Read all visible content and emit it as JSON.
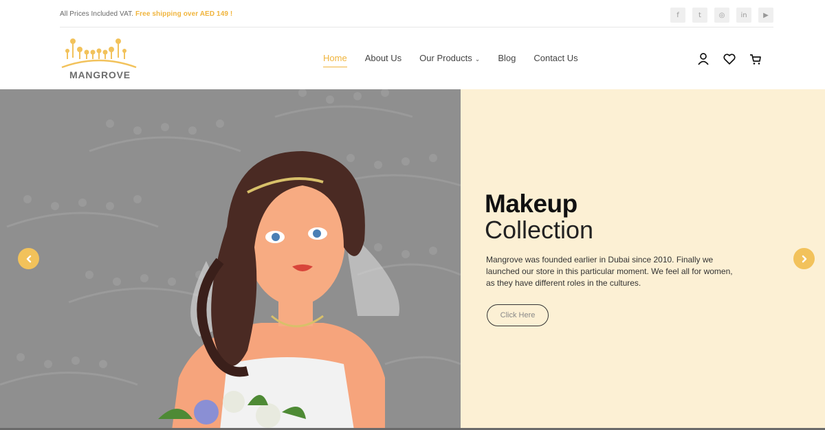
{
  "topbar": {
    "note_prefix": "All Prices Included VAT.",
    "note_highlight": "Free shipping over AED 149 !",
    "socials": [
      {
        "icon": "facebook-icon",
        "glyph": "f"
      },
      {
        "icon": "twitter-icon",
        "glyph": "t"
      },
      {
        "icon": "instagram-icon",
        "glyph": "◎"
      },
      {
        "icon": "linkedin-icon",
        "glyph": "in"
      },
      {
        "icon": "youtube-icon",
        "glyph": "▶"
      }
    ]
  },
  "header": {
    "brand": "MANGROVE",
    "nav": [
      {
        "label": "Home",
        "active": true
      },
      {
        "label": "About Us",
        "active": false
      },
      {
        "label": "Our Products",
        "active": false
      },
      {
        "label": "Blog",
        "active": false
      },
      {
        "label": "Contact Us",
        "active": false
      }
    ],
    "icons": [
      "user-icon",
      "heart-icon",
      "cart-icon"
    ]
  },
  "hero": {
    "title": "Makeup",
    "subtitle": "Collection",
    "text": "Mangrove was founded earlier in Dubai since 2010. Finally we launched our store in this particular moment. We feel all for women, as they have different roles in the cultures.",
    "button": "Click Here"
  },
  "colors": {
    "accent": "#f0b43c",
    "hero_left_bg": "#8f8f8f",
    "hero_right_bg": "#fcf0d4",
    "arrow_bg": "#f2c25b"
  }
}
